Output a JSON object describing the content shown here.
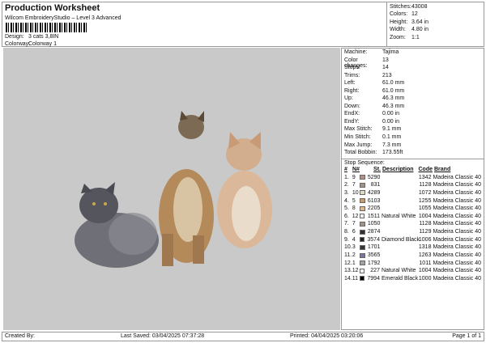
{
  "header": {
    "title": "Production Worksheet",
    "subtitle": "Wilcom EmbroideryStudio – Level 3 Advanced",
    "design_label": "Design:",
    "design": "3 cats 3,8IN",
    "colorway_label": "Colorway:",
    "colorway": "Colorway 1"
  },
  "stats": [
    {
      "k": "Stitches:",
      "v": "43008"
    },
    {
      "k": "Colors:",
      "v": "12"
    },
    {
      "k": "Height:",
      "v": "3.64 in"
    },
    {
      "k": "Width:",
      "v": "4.80 in"
    },
    {
      "k": "Zoom:",
      "v": "1:1"
    }
  ],
  "info": [
    {
      "k": "Machine:",
      "v": "Tajima"
    },
    {
      "k": "Color changes:",
      "v": "13"
    },
    {
      "k": "Stops:",
      "v": "14"
    },
    {
      "k": "Trims:",
      "v": "213"
    },
    {
      "k": "Left:",
      "v": "61.0 mm"
    },
    {
      "k": "Right:",
      "v": "61.0 mm"
    },
    {
      "k": "Up:",
      "v": "46.3 mm"
    },
    {
      "k": "Down:",
      "v": "46.3 mm"
    },
    {
      "k": "EndX:",
      "v": "0.00 in"
    },
    {
      "k": "EndY:",
      "v": "0.00 in"
    },
    {
      "k": "Max Stitch:",
      "v": "9.1 mm"
    },
    {
      "k": "Min Stitch:",
      "v": "0.1 mm"
    },
    {
      "k": "Max Jump:",
      "v": "7.3 mm"
    },
    {
      "k": "Total Bobbin:",
      "v": "173.55ft"
    }
  ],
  "stop_sequence": {
    "title": "Stop Sequence:",
    "headers": [
      "#",
      "N#",
      "St.",
      "Description",
      "Code",
      "Brand"
    ],
    "rows": [
      {
        "n": "1.",
        "nn": "9",
        "color": "#b88f7e",
        "st": "5290",
        "desc": "",
        "code": "1342",
        "brand": "Madeira Classic 40"
      },
      {
        "n": "2.",
        "nn": "7",
        "color": "#a39282",
        "st": "831",
        "desc": "",
        "code": "1128",
        "brand": "Madeira Classic 40"
      },
      {
        "n": "3.",
        "nn": "10",
        "color": "#e2d9c2",
        "st": "4289",
        "desc": "",
        "code": "1072",
        "brand": "Madeira Classic 40"
      },
      {
        "n": "4.",
        "nn": "5",
        "color": "#d4955f",
        "st": "6103",
        "desc": "",
        "code": "1255",
        "brand": "Madeira Classic 40"
      },
      {
        "n": "5.",
        "nn": "8",
        "color": "#e3b582",
        "st": "2205",
        "desc": "",
        "code": "1055",
        "brand": "Madeira Classic 40"
      },
      {
        "n": "6.",
        "nn": "12",
        "color": "#f0f0f0",
        "st": "1511",
        "desc": "Natural White",
        "code": "1004",
        "brand": "Madeira Classic 40"
      },
      {
        "n": "7.",
        "nn": "7",
        "color": "#a39282",
        "st": "1050",
        "desc": "",
        "code": "1128",
        "brand": "Madeira Classic 40"
      },
      {
        "n": "8.",
        "nn": "6",
        "color": "#3e2e28",
        "st": "2874",
        "desc": "",
        "code": "1129",
        "brand": "Madeira Classic 40"
      },
      {
        "n": "9.",
        "nn": "4",
        "color": "#222222",
        "st": "3574",
        "desc": "Diamond Black",
        "code": "1006",
        "brand": "Madeira Classic 40"
      },
      {
        "n": "10.",
        "nn": "3",
        "color": "#33333a",
        "st": "1701",
        "desc": "",
        "code": "1318",
        "brand": "Madeira Classic 40"
      },
      {
        "n": "11.",
        "nn": "2",
        "color": "#7a73a3",
        "st": "3565",
        "desc": "",
        "code": "1263",
        "brand": "Madeira Classic 40"
      },
      {
        "n": "12.",
        "nn": "1",
        "color": "#a2a2a2",
        "st": "1792",
        "desc": "",
        "code": "1011",
        "brand": "Madeira Classic 40"
      },
      {
        "n": "13.",
        "nn": "12",
        "color": "#f0f0f0",
        "st": "227",
        "desc": "Natural White",
        "code": "1004",
        "brand": "Madeira Classic 40"
      },
      {
        "n": "14.",
        "nn": "11",
        "color": "#000000",
        "st": "7994",
        "desc": "Emerald Black",
        "code": "1000",
        "brand": "Madeira Classic 40"
      }
    ]
  },
  "footer": {
    "created": "Created By:",
    "saved": "Last Saved: 03/04/2025 07:37:28",
    "printed": "Printed: 04/04/2025 03:20:06",
    "page": "Page 1 of 1"
  }
}
